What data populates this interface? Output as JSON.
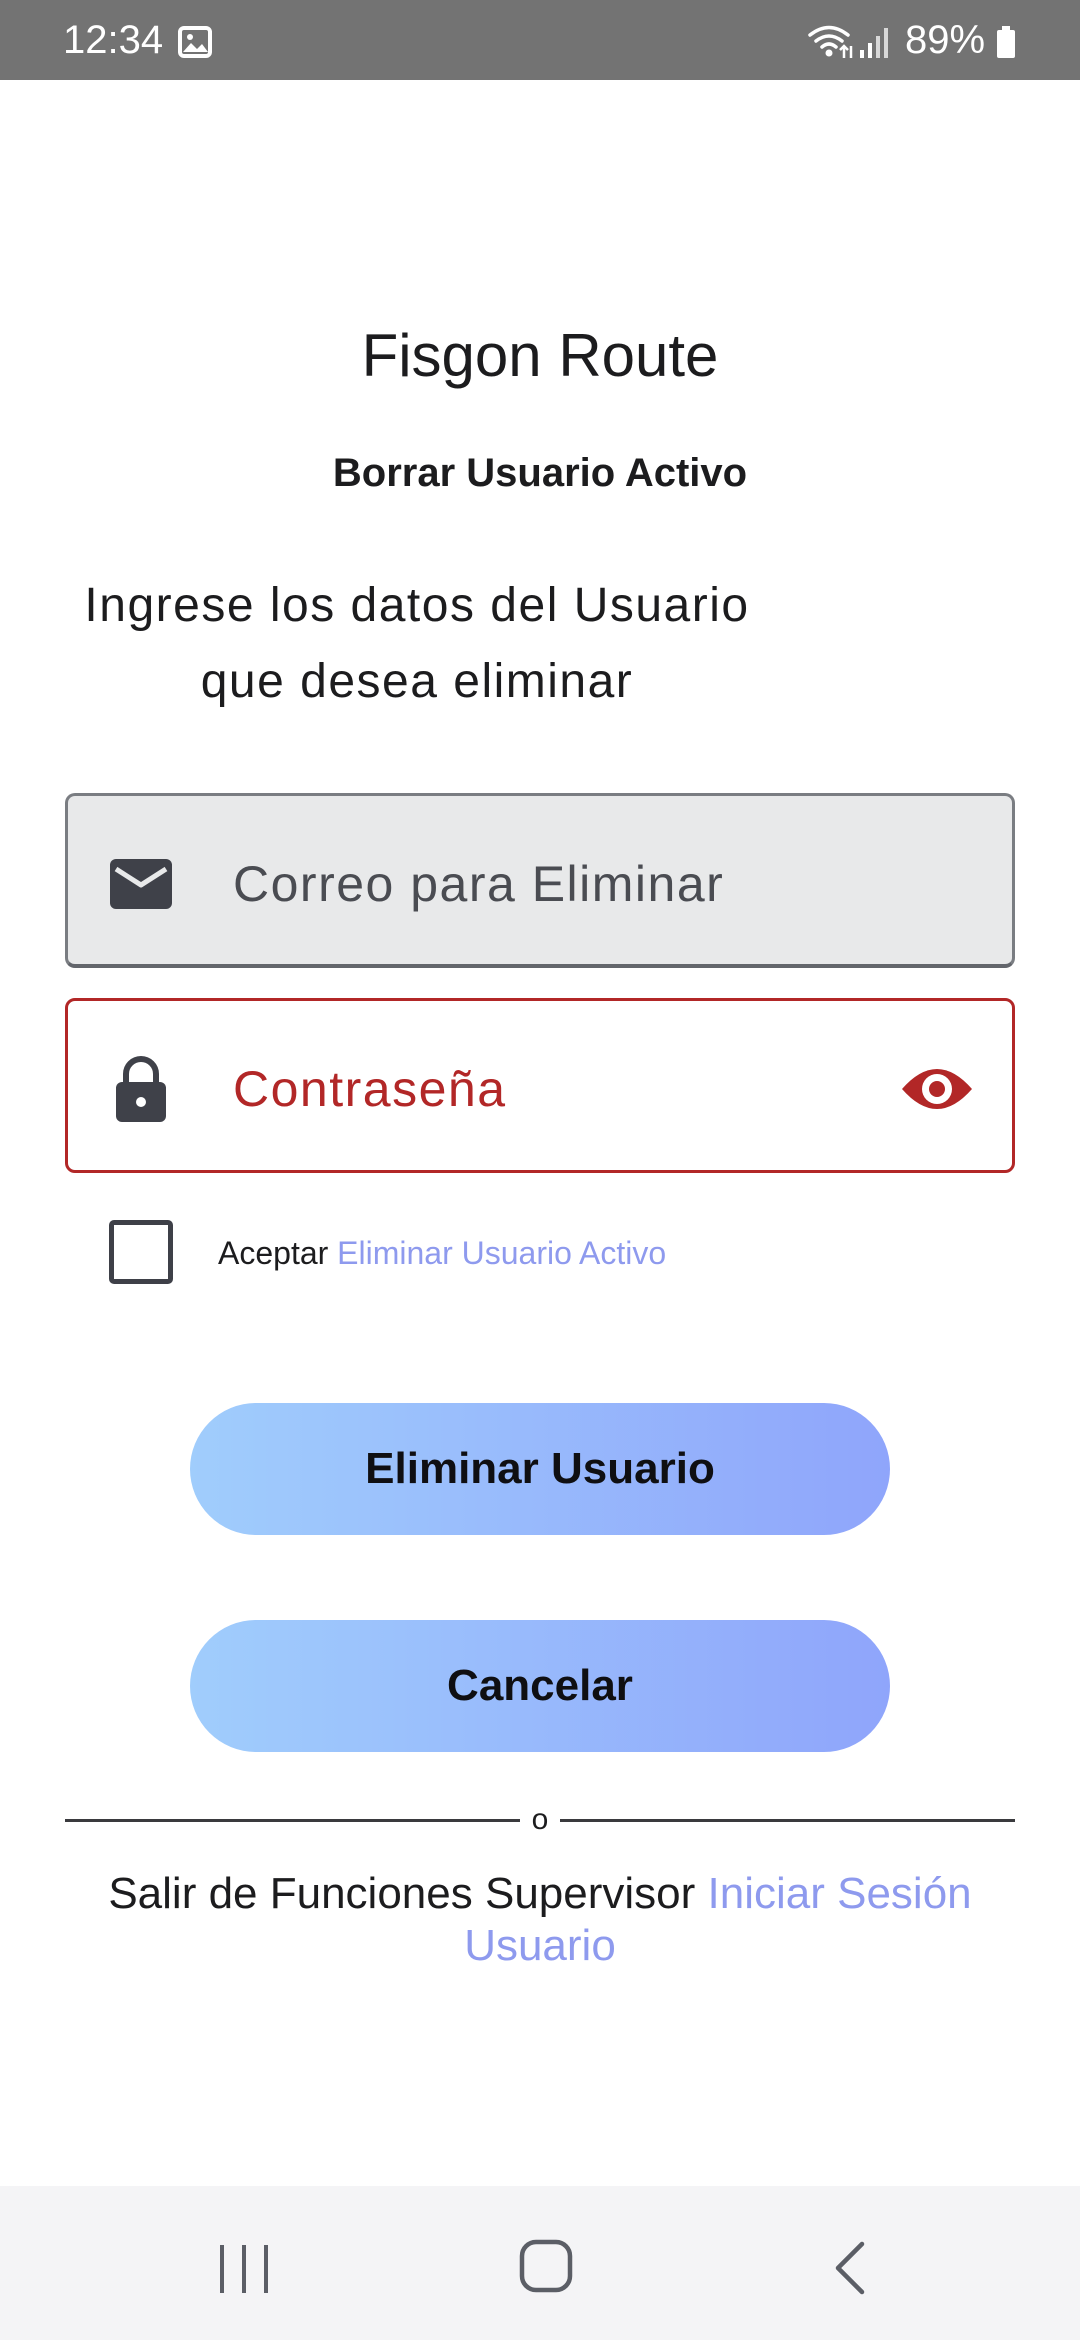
{
  "status_bar": {
    "time": "12:34",
    "battery": "89%",
    "icons": [
      "gallery-icon",
      "wifi-icon",
      "signal-icon",
      "battery-icon"
    ]
  },
  "app_title": "Fisgon Route",
  "subtitle": "Borrar Usuario Activo",
  "instruction": "Ingrese los datos del Usuario que desea eliminar",
  "email_field": {
    "placeholder": "Correo para Eliminar",
    "icon": "mail-icon"
  },
  "password_field": {
    "placeholder": "Contraseña",
    "icon": "lock-icon",
    "toggle_icon": "eye-icon",
    "error_color": "#b22727"
  },
  "checkbox": {
    "checked": false,
    "label": "Aceptar",
    "link": "Eliminar Usuario Activo"
  },
  "buttons": {
    "delete": "Eliminar Usuario",
    "cancel": "Cancelar"
  },
  "divider_text": "o",
  "footer": {
    "text": "Salir de Funciones Supervisor",
    "link": "Iniciar Sesión Usuario"
  },
  "colors": {
    "link": "#8e9aee",
    "button_gradient_start": "#a0cdfc",
    "button_gradient_end": "#8fa5fb",
    "status_bar": "#737373"
  },
  "nav_bar": {
    "icons": [
      "recent-apps-icon",
      "home-icon",
      "back-icon"
    ]
  }
}
